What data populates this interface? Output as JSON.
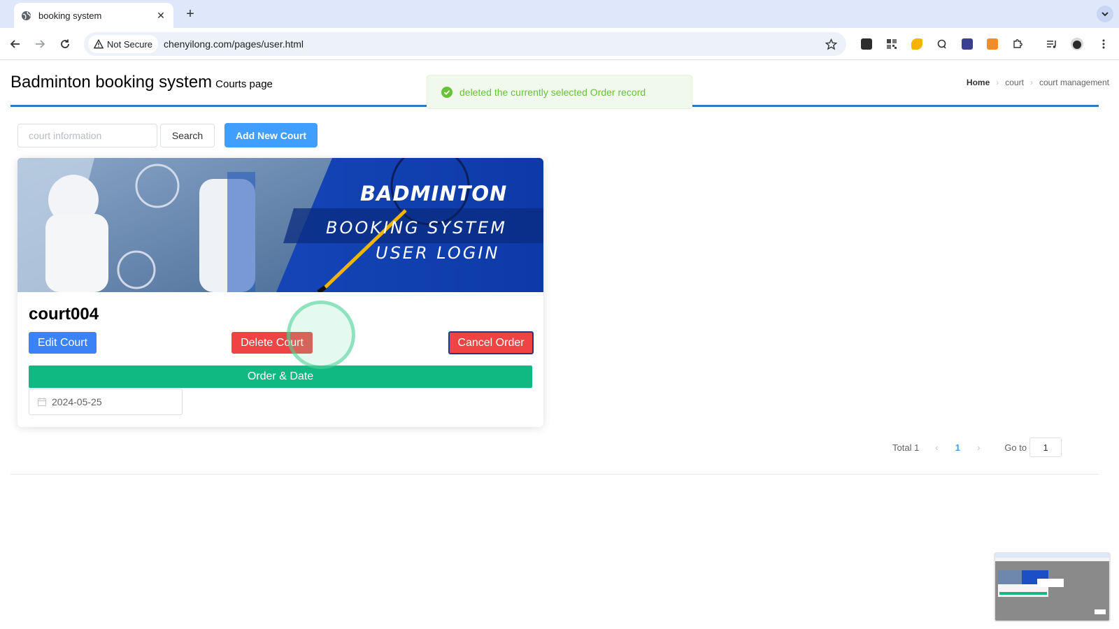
{
  "browser": {
    "tab_title": "booking system",
    "close_glyph": "✕",
    "newtab_glyph": "+",
    "security_label": "Not Secure",
    "url": "chenyilong.com/pages/user.html"
  },
  "page": {
    "title": "Badminton booking system",
    "subtitle": "Courts page",
    "breadcrumb": [
      "Home",
      "court",
      "court management"
    ]
  },
  "toast": {
    "message": "deleted the currently selected Order record",
    "color": "#67c23a"
  },
  "toolbar": {
    "search_placeholder": "court information",
    "search_label": "Search",
    "add_label": "Add New Court"
  },
  "card": {
    "banner": {
      "title": "BADMINTON",
      "line1": "BOOKING SYSTEM",
      "line2": "USER LOGIN"
    },
    "court_name": "court004",
    "edit_label": "Edit Court",
    "delete_label": "Delete Court",
    "cancel_label": "Cancel Order",
    "order_label": "Order & Date",
    "date_value": "2024-05-25"
  },
  "pagination": {
    "total_label": "Total 1",
    "current_page": "1",
    "goto_label": "Go to",
    "goto_value": "1"
  },
  "colors": {
    "primary": "#409eff",
    "danger": "#ef4444",
    "success": "#10b981",
    "header_line": "#2f7ab8"
  }
}
